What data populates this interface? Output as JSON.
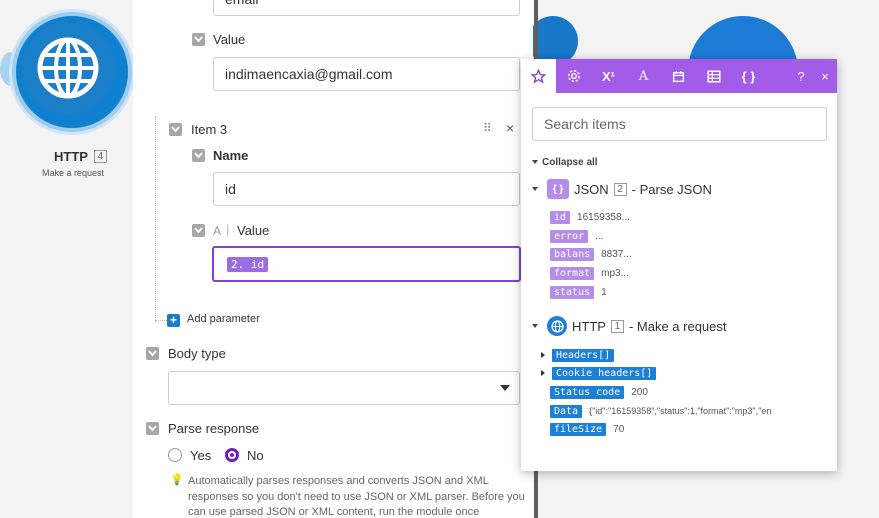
{
  "canvas": {
    "module": {
      "name": "HTTP",
      "number": "4",
      "subtitle": "Make a request"
    }
  },
  "panel": {
    "item2": {
      "name_value": "email",
      "value_label": "Value",
      "value": "indimaencaxia@gmail.com"
    },
    "item3": {
      "label": "Item 3",
      "name_label": "Name",
      "name_value": "id",
      "value_label": "Value",
      "mapped_pill": "2. id"
    },
    "add_parameter": "Add parameter",
    "body_type": {
      "label": "Body type",
      "value": ""
    },
    "parse_response": {
      "label": "Parse response",
      "yes": "Yes",
      "no": "No",
      "selected": "No",
      "help": "Automatically parses responses and converts JSON and XML responses so you don't need to use JSON or XML parser. Before you can use parsed JSON or XML content, run the module once"
    }
  },
  "picker": {
    "toolbar": {
      "tabs": [
        "star-icon",
        "gear-icon",
        "superscript-icon",
        "text-icon",
        "calendar-icon",
        "table-icon",
        "braces-icon"
      ],
      "help": "?",
      "close": "×"
    },
    "search_placeholder": "Search items",
    "collapse_all": "Collapse all",
    "groups": [
      {
        "app": "JSON",
        "number": "2",
        "title": "- Parse JSON",
        "color": "#b68ce9",
        "items": [
          {
            "key": "id",
            "value": "16159358..."
          },
          {
            "key": "error",
            "value": "..."
          },
          {
            "key": "balans",
            "value": "8837..."
          },
          {
            "key": "format",
            "value": "mp3..."
          },
          {
            "key": "status",
            "value": "1"
          }
        ]
      },
      {
        "app": "HTTP",
        "number": "1",
        "title": "- Make a request",
        "color": "#1d7fd6",
        "items": [
          {
            "key": "Headers[]",
            "value": ""
          },
          {
            "key": "Cookie headers[]",
            "value": ""
          },
          {
            "key": "Status code",
            "value": "200"
          },
          {
            "key": "Data",
            "value": "{\"id\":\"16159358\",\"status\":1,\"format\":\"mp3\",\"en"
          },
          {
            "key": "fileSize",
            "value": "70"
          }
        ]
      }
    ]
  }
}
